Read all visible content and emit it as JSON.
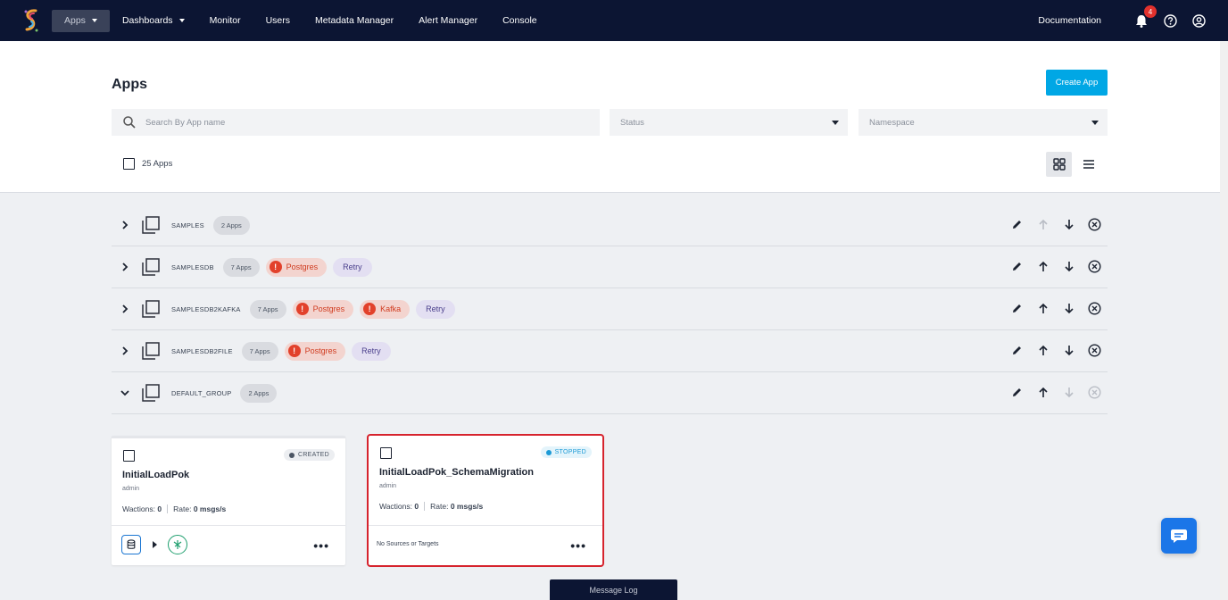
{
  "nav": {
    "items": [
      {
        "label": "Apps"
      },
      {
        "label": "Dashboards"
      },
      {
        "label": "Monitor"
      },
      {
        "label": "Users"
      },
      {
        "label": "Metadata Manager"
      },
      {
        "label": "Alert Manager"
      },
      {
        "label": "Console"
      }
    ],
    "documentation": "Documentation",
    "notification_count": "4"
  },
  "page": {
    "title": "Apps",
    "create_button": "Create App",
    "search_placeholder": "Search By App name",
    "status_select": "Status",
    "namespace_select": "Namespace",
    "app_count": "25 Apps"
  },
  "groups": [
    {
      "name": "SAMPLES",
      "count": "2 Apps",
      "errors": [],
      "retry": ""
    },
    {
      "name": "SAMPLESDB",
      "count": "7 Apps",
      "errors": [
        "Postgres"
      ],
      "retry": "Retry"
    },
    {
      "name": "SAMPLESDB2KAFKA",
      "count": "7 Apps",
      "errors": [
        "Postgres",
        "Kafka"
      ],
      "retry": "Retry"
    },
    {
      "name": "SAMPLESDB2FILE",
      "count": "7 Apps",
      "errors": [
        "Postgres"
      ],
      "retry": "Retry"
    },
    {
      "name": "DEFAULT_GROUP",
      "count": "2 Apps",
      "errors": [],
      "retry": ""
    }
  ],
  "apps": [
    {
      "name": "InitialLoadPok",
      "owner": "admin",
      "status": "CREATED",
      "wactions_label": "Wactions:",
      "wactions": "0",
      "rate_label": "Rate:",
      "rate": "0 msgs/s",
      "footer": ""
    },
    {
      "name": "InitialLoadPok_SchemaMigration",
      "owner": "admin",
      "status": "STOPPED",
      "wactions_label": "Wactions:",
      "wactions": "0",
      "rate_label": "Rate:",
      "rate": "0 msgs/s",
      "footer": "No Sources or Targets"
    }
  ],
  "message_log": "Message Log",
  "colors": {
    "nav_bg": "#0c1533",
    "accent": "#00a7e5",
    "error": "#d03b1f",
    "stopped": "#1b9ad6",
    "highlight": "#d6232d"
  }
}
